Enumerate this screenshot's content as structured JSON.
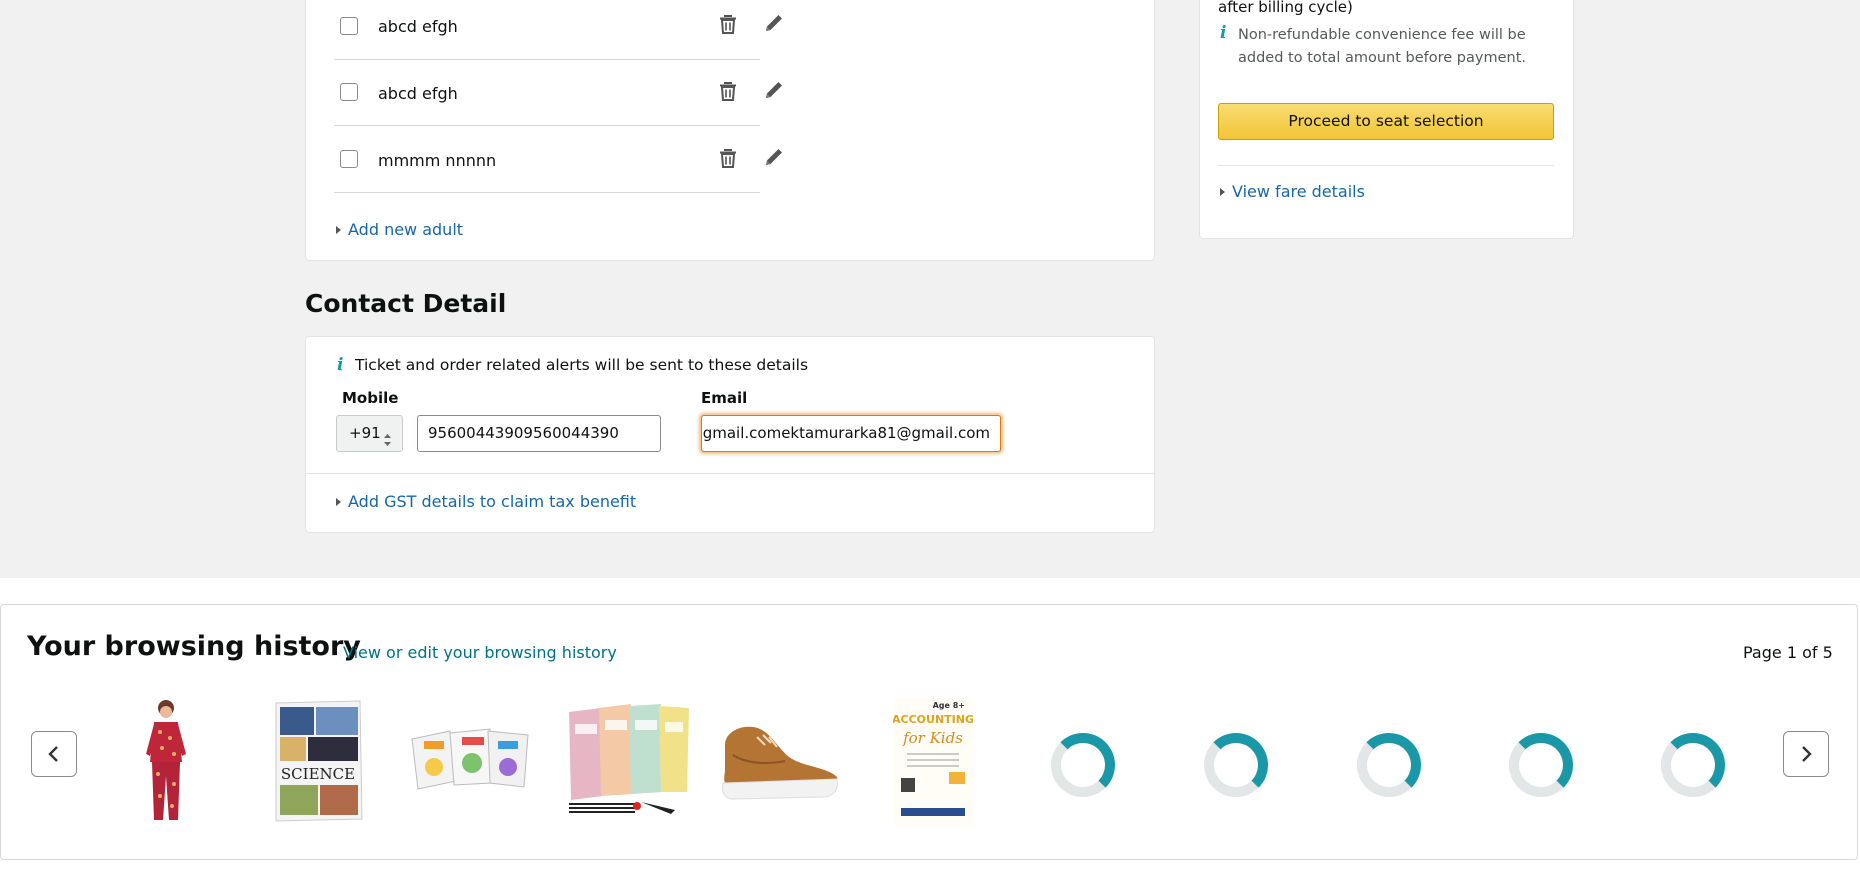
{
  "travellers": {
    "list": [
      {
        "name": "abcd efgh",
        "checked": false
      },
      {
        "name": "abcd efgh",
        "checked": false
      },
      {
        "name": "mmmm nnnnn",
        "checked": false
      }
    ],
    "add_adult_label": "Add new adult"
  },
  "sidebar": {
    "billing_fragment": "after billing cycle)",
    "fee_note": "Non-refundable convenience fee will be added to total amount before payment.",
    "proceed_label": "Proceed to seat selection",
    "fare_link": "View fare details",
    "button_color": "#f7ca00"
  },
  "contact": {
    "title": "Contact Detail",
    "info_text": "Ticket and order related alerts will be sent to these details",
    "mobile_label": "Mobile",
    "country_code": "+91",
    "mobile_value": "95600443909560044390",
    "email_label": "Email",
    "email_value": "gmail.comektamurarka81@gmail.com",
    "gst_link": "Add GST details to claim tax benefit"
  },
  "browsing": {
    "title": "Your browsing history",
    "edit_link": "View or edit your browsing history",
    "page_indicator": "Page 1 of 5",
    "items": [
      {
        "icon": "pajama-set-product"
      },
      {
        "icon": "science-book-product",
        "text": "SCIENCE"
      },
      {
        "icon": "activity-books-product"
      },
      {
        "icon": "magic-books-set-product"
      },
      {
        "icon": "brown-sneaker-product"
      },
      {
        "icon": "accounting-for-kids-book-product",
        "text": "ACCOUNTING",
        "text2": "for Kids",
        "badge": "Age 8+"
      },
      {
        "icon": "loading-spinner"
      },
      {
        "icon": "loading-spinner"
      },
      {
        "icon": "loading-spinner"
      },
      {
        "icon": "loading-spinner"
      },
      {
        "icon": "loading-spinner"
      }
    ]
  },
  "colors": {
    "link": "#1567a8",
    "accent_teal": "#1a98a7",
    "focus_orange": "#e77600"
  }
}
